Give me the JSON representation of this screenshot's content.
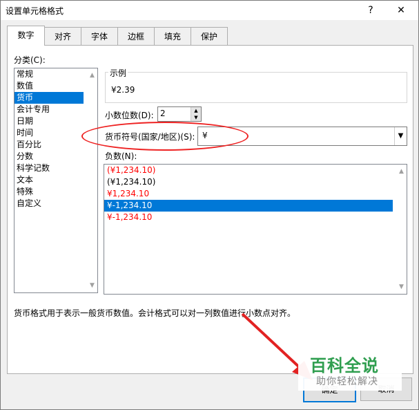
{
  "window": {
    "title": "设置单元格格式",
    "help": "?",
    "close": "✕"
  },
  "tabs": [
    {
      "label": "数字",
      "active": true
    },
    {
      "label": "对齐"
    },
    {
      "label": "字体"
    },
    {
      "label": "边框"
    },
    {
      "label": "填充"
    },
    {
      "label": "保护"
    }
  ],
  "category": {
    "label": "分类(C):",
    "items": [
      "常规",
      "数值",
      "货币",
      "会计专用",
      "日期",
      "时间",
      "百分比",
      "分数",
      "科学记数",
      "文本",
      "特殊",
      "自定义"
    ],
    "selected": "货币"
  },
  "sample": {
    "legend": "示例",
    "value": "¥2.39"
  },
  "decimals": {
    "label": "小数位数(D):",
    "value": "2"
  },
  "symbol": {
    "label": "货币符号(国家/地区)(S):",
    "value": "¥"
  },
  "negative": {
    "label": "负数(N):",
    "items": [
      {
        "text": "(¥1,234.10)",
        "red": true
      },
      {
        "text": "(¥1,234.10)",
        "red": false
      },
      {
        "text": "¥1,234.10",
        "red": true
      },
      {
        "text": "¥-1,234.10",
        "red": false,
        "selected": true
      },
      {
        "text": "¥-1,234.10",
        "red": true
      }
    ]
  },
  "description": "货币格式用于表示一般货币数值。会计格式可以对一列数值进行小数点对齐。",
  "buttons": {
    "ok": "确定",
    "cancel": "取消"
  },
  "watermark": {
    "title": "百科全说",
    "subtitle": "助你轻松解决"
  },
  "colors": {
    "selection": "#0078d7",
    "annotation": "#e22222",
    "watermark": "#2f9e4f",
    "negative_red": "#ff0000"
  }
}
